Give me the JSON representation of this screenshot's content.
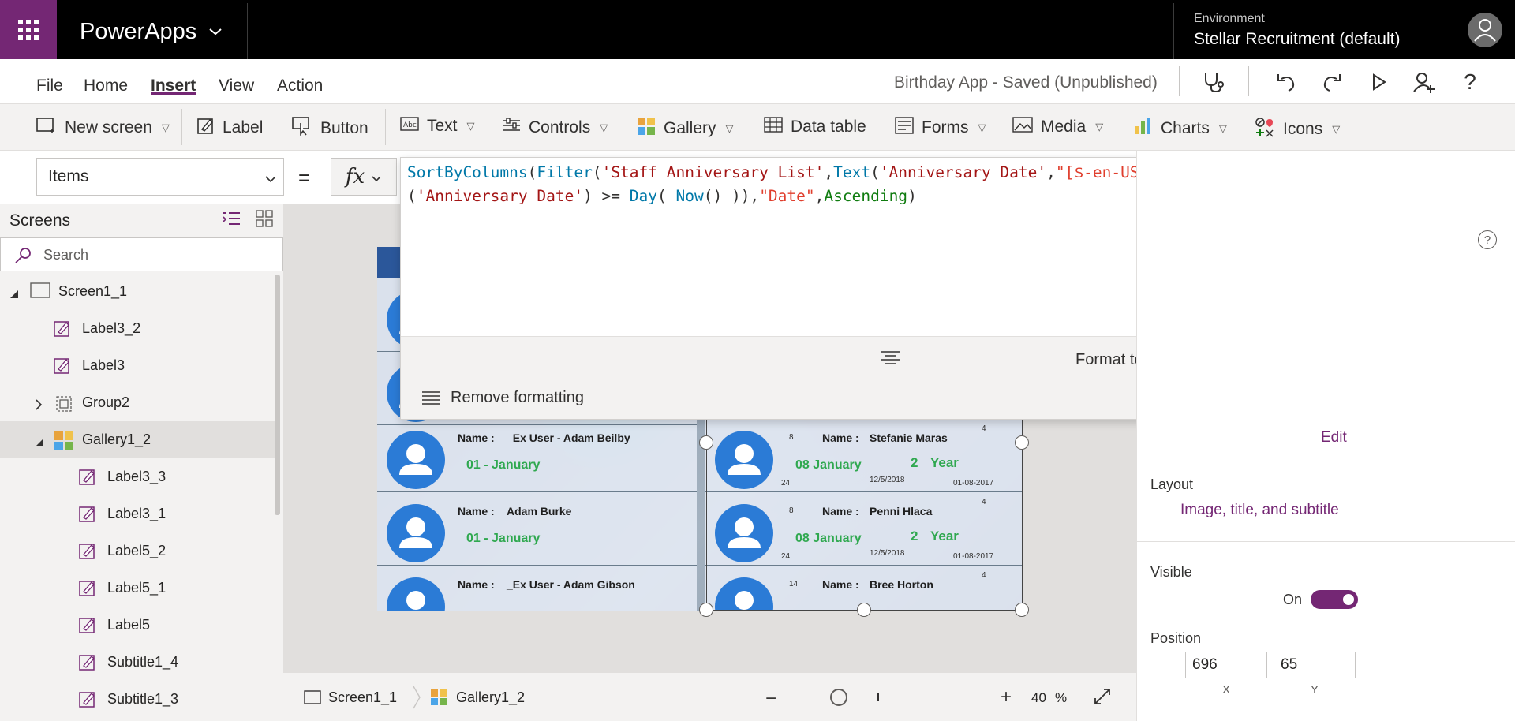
{
  "app": {
    "title": "PowerApps",
    "env_label": "Environment",
    "env_name": "Stellar Recruitment (default)"
  },
  "menu": {
    "items": [
      "File",
      "Home",
      "Insert",
      "View",
      "Action"
    ],
    "active": "Insert",
    "saved_status": "Birthday App - Saved (Unpublished)"
  },
  "ribbon": {
    "new_screen": "New screen",
    "label": "Label",
    "button": "Button",
    "text": "Text",
    "controls": "Controls",
    "gallery": "Gallery",
    "data_table": "Data table",
    "forms": "Forms",
    "media": "Media",
    "charts": "Charts",
    "icons": "Icons"
  },
  "formula": {
    "property": "Items",
    "equals": "=",
    "fx": "fx",
    "format_text": "Format text",
    "remove_formatting": "Remove formatting"
  },
  "tree": {
    "title": "Screens",
    "search_placeholder": "Search",
    "items": [
      {
        "label": "Screen1_1",
        "icon": "screen-icon",
        "level": 0,
        "expander": "expanded"
      },
      {
        "label": "Label3_2",
        "icon": "label-icon",
        "level": 1
      },
      {
        "label": "Label3",
        "icon": "label-icon",
        "level": 1
      },
      {
        "label": "Group2",
        "icon": "group-icon",
        "level": 1,
        "expander": "collapsed"
      },
      {
        "label": "Gallery1_2",
        "icon": "gallery-icon",
        "level": 1,
        "expander": "expanded",
        "selected": true
      },
      {
        "label": "Label3_3",
        "icon": "label-icon",
        "level": 2
      },
      {
        "label": "Label3_1",
        "icon": "label-icon",
        "level": 2
      },
      {
        "label": "Label5_2",
        "icon": "label-icon",
        "level": 2
      },
      {
        "label": "Label5_1",
        "icon": "label-icon",
        "level": 2
      },
      {
        "label": "Label5",
        "icon": "label-icon",
        "level": 2
      },
      {
        "label": "Subtitle1_4",
        "icon": "label-icon",
        "level": 2
      },
      {
        "label": "Subtitle1_3",
        "icon": "label-icon",
        "level": 2
      }
    ]
  },
  "gallery_left": {
    "name_label": "Name :",
    "cards": [
      {
        "name": "_Ex User -  Adam Beilby",
        "date": "01 - January"
      },
      {
        "name": "Adam Burke",
        "date": "01 - January"
      },
      {
        "name": "_Ex User - Adam Gibson",
        "date": ""
      }
    ]
  },
  "gallery_right": {
    "name_label": "Name :",
    "year_label": "Year",
    "cards": [
      {
        "name": "Stefanie Maras",
        "date": "08 January",
        "years": "2",
        "top_num": "8",
        "corner": "4",
        "bottom_num": "24",
        "date1": "12/5/2018",
        "date2": "01-08-2017"
      },
      {
        "name": "Penni Hlaca",
        "date": "08 January",
        "years": "2",
        "top_num": "8",
        "corner": "4",
        "bottom_num": "24",
        "date1": "12/5/2018",
        "date2": "01-08-2017"
      },
      {
        "name": "Bree Horton",
        "date": "",
        "years": "",
        "top_num": "14",
        "corner": "4",
        "bottom_num": "",
        "date1": "",
        "date2": ""
      }
    ]
  },
  "statusbar": {
    "screen": "Screen1_1",
    "gallery": "Gallery1_2",
    "zoom": "40",
    "zoom_unit": "%"
  },
  "props": {
    "edit": "Edit",
    "layout_label": "Layout",
    "layout_value": "Image, title, and subtitle",
    "visible_label": "Visible",
    "visible_value": "On",
    "position_label": "Position",
    "x_value": "696",
    "y_value": "65",
    "x_label": "X",
    "y_label": "Y"
  }
}
